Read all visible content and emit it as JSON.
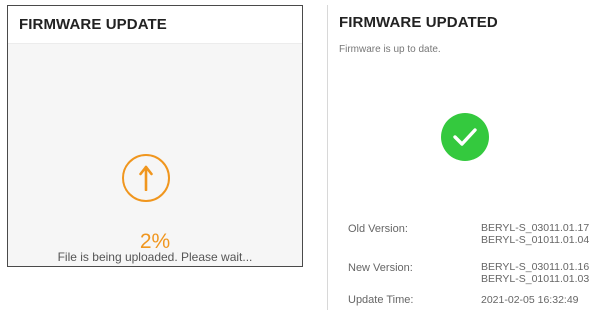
{
  "upload_panel": {
    "title": "FIRMWARE UPDATE",
    "icon": "upload-arrow-icon",
    "progress_percent": 2,
    "progress_label": "2%",
    "status_text": "File is being uploaded. Please wait...",
    "accent_color": "#f0961e"
  },
  "result_panel": {
    "title": "FIRMWARE UPDATED",
    "subtitle": "Firmware is up to date.",
    "icon": "checkmark-icon",
    "success_color": "#34c93e",
    "old_version": {
      "label": "Old Version:",
      "values": [
        "BERYL-S_03011.01.17",
        "BERYL-S_01011.01.04"
      ]
    },
    "new_version": {
      "label": "New Version:",
      "values": [
        "BERYL-S_03011.01.16",
        "BERYL-S_01011.01.03"
      ]
    },
    "update_time": {
      "label": "Update Time:",
      "value": "2021-02-05 16:32:49"
    }
  }
}
